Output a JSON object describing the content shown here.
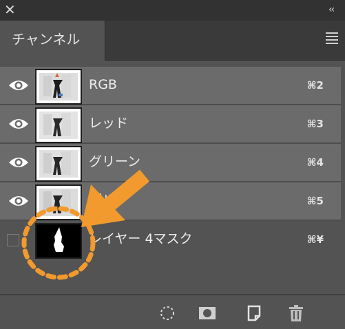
{
  "panel": {
    "close_icon": "✕",
    "collapse_icon": "‹‹",
    "tab_label": "チャンネル",
    "menu_icon": "hamburger-menu-icon"
  },
  "channels": [
    {
      "name": "RGB",
      "shortcut": "⌘2",
      "visible": true
    },
    {
      "name": "レッド",
      "shortcut": "⌘3",
      "visible": true
    },
    {
      "name": "グリーン",
      "shortcut": "⌘4",
      "visible": true
    },
    {
      "name": "ブルー",
      "shortcut": "⌘5",
      "visible": true
    },
    {
      "name": "レイヤー 4マスク",
      "shortcut": "⌘¥",
      "visible": false
    }
  ],
  "footer_icons": [
    "load-selection-icon",
    "save-selection-icon",
    "new-channel-icon",
    "trash-icon"
  ],
  "colors": {
    "panel_bg": "#535353",
    "row_bg": "#6b6b6b",
    "annotation_orange": "#f29a2e"
  }
}
